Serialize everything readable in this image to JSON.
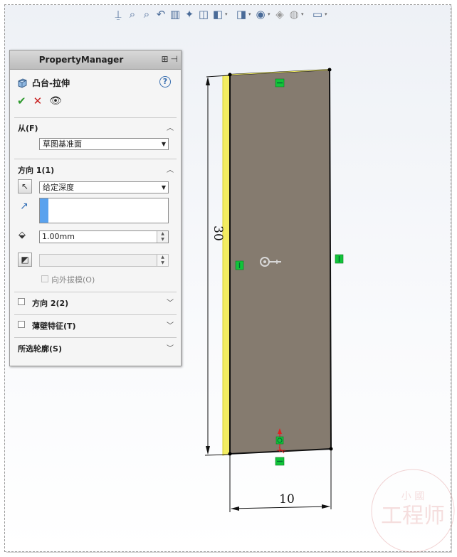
{
  "property_manager": {
    "title": "PropertyManager",
    "feature_name": "凸台-拉伸",
    "help_label": "?",
    "from_section": {
      "title": "从(F)",
      "start_condition": "草图基准面"
    },
    "direction1_section": {
      "title": "方向 1(1)",
      "end_condition": "给定深度",
      "depth_value": "1.00mm",
      "draft_label": "向外拔模(O)"
    },
    "direction2_section": {
      "title": "方向 2(2)"
    },
    "thin_feature_section": {
      "title": "薄壁特征(T)"
    },
    "selected_contours_section": {
      "title": "所选轮廓(S)"
    }
  },
  "sketch": {
    "height_dimension": "30",
    "width_dimension": "10"
  },
  "colors": {
    "face_fill": "#857b6f",
    "preview_edge": "#f2ec61",
    "relation_marker": "#12c43a",
    "accent_blue": "#5aa2ee"
  }
}
